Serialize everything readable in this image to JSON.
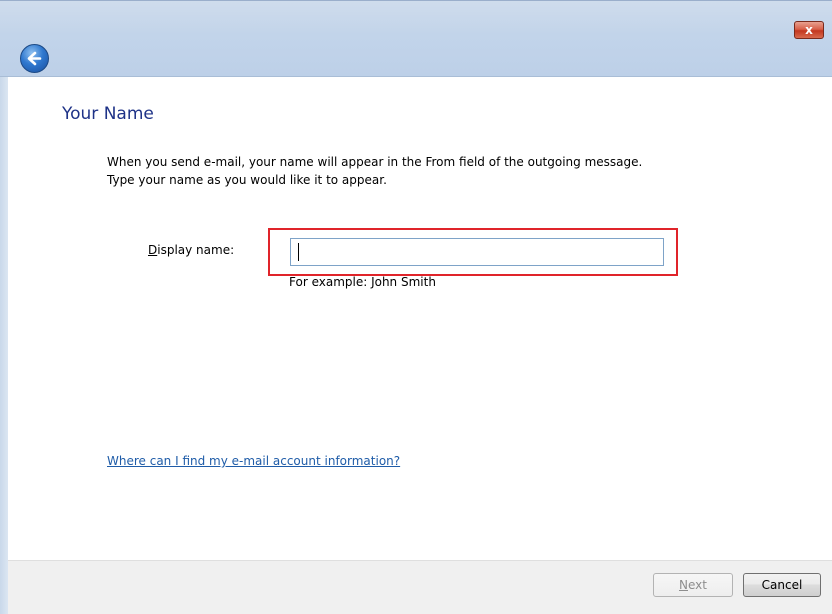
{
  "window": {
    "close_glyph": "x"
  },
  "page": {
    "heading": "Your Name",
    "description_line1": "When you send e-mail, your name will appear in the From field of the outgoing message.",
    "description_line2": "Type your name as you would like it to appear."
  },
  "form": {
    "display_name_label_access_key": "D",
    "display_name_label_rest": "isplay name:",
    "display_name_value": "",
    "display_name_hint": "For example: John Smith"
  },
  "help": {
    "link_text": "Where can I find my e-mail account information?"
  },
  "footer": {
    "next_access_key": "N",
    "next_rest": "ext",
    "next_enabled": false,
    "cancel_label": "Cancel"
  },
  "colors": {
    "heading": "#1e3287",
    "link": "#1f5ca8",
    "highlight_box": "#e0242a"
  },
  "icons": {
    "back": "back-arrow-icon",
    "close": "close-icon"
  }
}
